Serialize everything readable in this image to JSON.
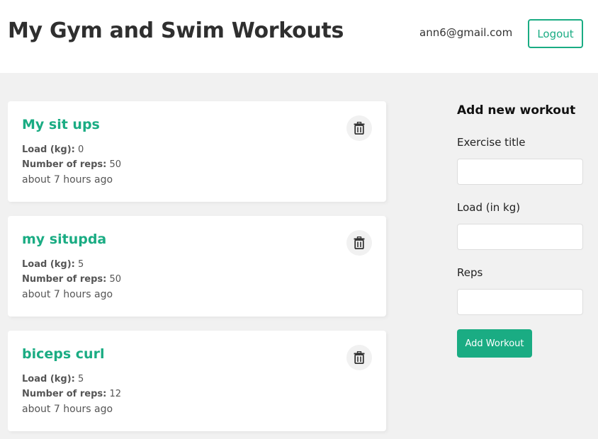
{
  "header": {
    "title": "My Gym and Swim Workouts",
    "user_email": "ann6@gmail.com",
    "logout_label": "Logout"
  },
  "workouts": [
    {
      "title": "My sit ups",
      "load_label": "Load (kg):",
      "load": "0",
      "reps_label": "Number of reps:",
      "reps": "50",
      "time": "about 7 hours ago"
    },
    {
      "title": "my situpda",
      "load_label": "Load (kg):",
      "load": "5",
      "reps_label": "Number of reps:",
      "reps": "50",
      "time": "about 7 hours ago"
    },
    {
      "title": "biceps curl",
      "load_label": "Load (kg):",
      "load": "5",
      "reps_label": "Number of reps:",
      "reps": "12",
      "time": "about 7 hours ago"
    }
  ],
  "icons": {
    "delete": "trash-icon"
  },
  "form": {
    "title": "Add new workout",
    "exercise_label": "Exercise title",
    "exercise_value": "",
    "load_label": "Load (in kg)",
    "load_value": "",
    "reps_label": "Reps",
    "reps_value": "",
    "submit_label": "Add Workout"
  },
  "colors": {
    "accent": "#1aac83",
    "background": "#f1f1f1",
    "card": "#ffffff"
  }
}
